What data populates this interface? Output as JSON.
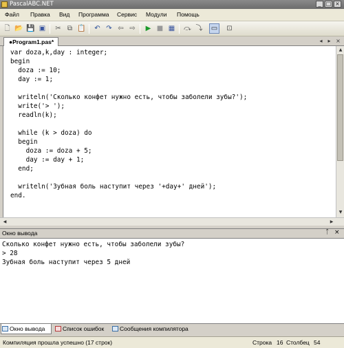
{
  "window": {
    "title": "PascalABC.NET"
  },
  "menu": [
    "Файл",
    "Правка",
    "Вид",
    "Программа",
    "Сервис",
    "Модули",
    "Помощь"
  ],
  "editor": {
    "tab_label": "●Program1.pas*",
    "lines": [
      "var doza,k,day : integer;",
      "begin",
      "  doza := 10;",
      "  day := 1;",
      "",
      "  writeln('Сколько конфет нужно есть, чтобы заболели зубы?');",
      "  write('> ');",
      "  readln(k);",
      "",
      "  while (k > doza) do",
      "  begin",
      "    doza := doza + 5;",
      "    day := day + 1;",
      "  end;",
      "",
      "  writeln('Зубная боль наступит через '+day+' дней');",
      "end."
    ]
  },
  "output": {
    "title": "Окно вывода",
    "lines": [
      "Сколько конфет нужно есть, чтобы заболели зубы?",
      "> 28",
      "Зубная боль наступит через 5 дней"
    ]
  },
  "bottom_tabs": [
    "Окно вывода",
    "Список ошибок",
    "Сообщения компилятора"
  ],
  "status": {
    "message": "Компиляция прошла успешно (17 строк)",
    "line_label": "Строка",
    "line_value": "16",
    "col_label": "Столбец",
    "col_value": "54"
  }
}
